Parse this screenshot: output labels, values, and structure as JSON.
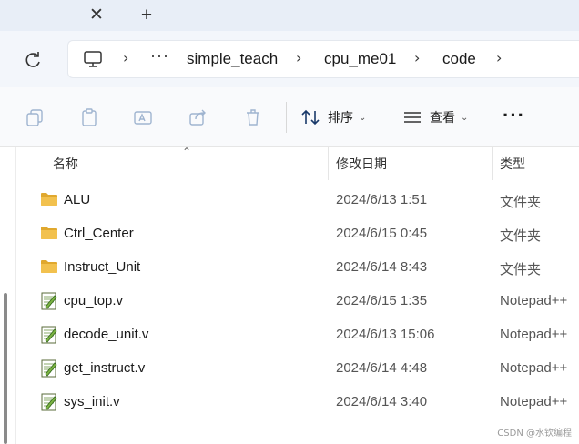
{
  "tabs": {
    "close_glyph": "✕",
    "add_glyph": "+"
  },
  "breadcrumb": {
    "more": "···",
    "separator": "›",
    "items": [
      "simple_teach",
      "cpu_me01",
      "code"
    ]
  },
  "toolbar": {
    "sort_label": "排序",
    "view_label": "查看",
    "more_glyph": "···"
  },
  "columns": {
    "name": "名称",
    "modified": "修改日期",
    "type": "类型"
  },
  "files": [
    {
      "name": "ALU",
      "modified": "2024/6/13 1:51",
      "type": "文件夹",
      "icon": "folder-icon"
    },
    {
      "name": "Ctrl_Center",
      "modified": "2024/6/15 0:45",
      "type": "文件夹",
      "icon": "folder-icon"
    },
    {
      "name": "Instruct_Unit",
      "modified": "2024/6/14 8:43",
      "type": "文件夹",
      "icon": "folder-icon"
    },
    {
      "name": "cpu_top.v",
      "modified": "2024/6/15 1:35",
      "type": "Notepad++",
      "icon": "notepad-file-icon"
    },
    {
      "name": "decode_unit.v",
      "modified": "2024/6/13 15:06",
      "type": "Notepad++",
      "icon": "notepad-file-icon"
    },
    {
      "name": "get_instruct.v",
      "modified": "2024/6/14 4:48",
      "type": "Notepad++",
      "icon": "notepad-file-icon"
    },
    {
      "name": "sys_init.v",
      "modified": "2024/6/14 3:40",
      "type": "Notepad++",
      "icon": "notepad-file-icon"
    }
  ],
  "watermark": "CSDN @水钦编程",
  "colors": {
    "folder": "#f2c14e",
    "folder_dark": "#e0a82e",
    "accent": "#1a1a1a"
  }
}
